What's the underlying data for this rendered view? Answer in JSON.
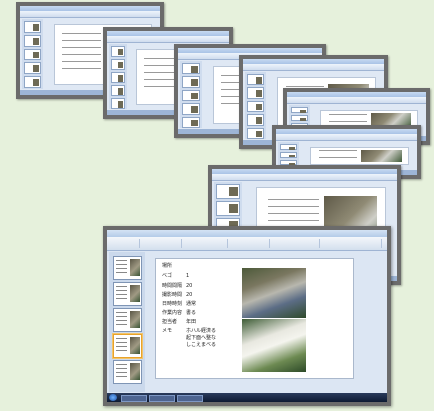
{
  "main_window": {
    "slide": {
      "header": "",
      "rows": [
        {
          "label": "場所",
          "value": ""
        },
        {
          "label": "ベゴ",
          "value": "1"
        },
        {
          "label": "時間間隔",
          "value": "20"
        },
        {
          "label": "撮影時間",
          "value": "20"
        },
        {
          "label": "日時時刻",
          "value": "通常"
        },
        {
          "label": "作業内容",
          "value": "書る"
        },
        {
          "label": "担当者",
          "value": "年田"
        },
        {
          "label": "メモ",
          "value": "ホハル経済る"
        },
        {
          "label": "",
          "value": "起下面へ整な"
        },
        {
          "label": "",
          "value": "しこえまべる"
        }
      ]
    }
  },
  "colors": {
    "background": "#e6f1dc",
    "window_frame": "#6b6b6b",
    "ribbon_blue": "#cfdcee",
    "selected_thumb": "#e8a32b"
  },
  "icons": [
    "start-orb-icon",
    "slide-thumbnail-icon"
  ]
}
